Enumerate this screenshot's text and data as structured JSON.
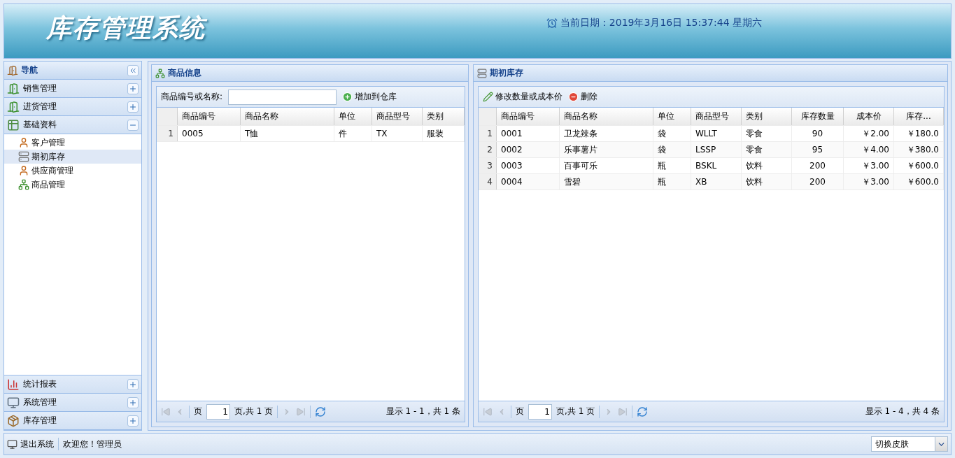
{
  "header": {
    "title": "库存管理系统",
    "date": "当前日期：2019年3月16日 15:37:44 星期六"
  },
  "sidebar": {
    "title": "导航",
    "sections": [
      {
        "label": "销售管理",
        "expanded": false
      },
      {
        "label": "进货管理",
        "expanded": false
      },
      {
        "label": "基础资料",
        "expanded": true,
        "children": [
          {
            "label": "客户管理",
            "selected": false
          },
          {
            "label": "期初库存",
            "selected": true
          },
          {
            "label": "供应商管理",
            "selected": false
          },
          {
            "label": "商品管理",
            "selected": false
          }
        ]
      },
      {
        "label": "统计报表",
        "expanded": false
      },
      {
        "label": "系统管理",
        "expanded": false
      },
      {
        "label": "库存管理",
        "expanded": false
      }
    ]
  },
  "panels": [
    {
      "title": "商品信息",
      "search_label": "商品编号或名称:",
      "toolbar": [
        "增加到仓库"
      ],
      "columns": [
        "商品编号",
        "商品名称",
        "单位",
        "商品型号",
        "类别"
      ],
      "rows": [
        {
          "number": "1",
          "cells": [
            "0005",
            "T恤",
            "件",
            "TX",
            "服装"
          ]
        }
      ],
      "pager": {
        "page_label": "页",
        "page": "1",
        "total_label": "页,共 1 页",
        "summary": "显示 1 - 1，共 1 条",
        "controls": [
          {
            "kind": "first",
            "disabled": true
          },
          {
            "kind": "prev",
            "disabled": true
          },
          {
            "kind": "next",
            "disabled": true
          },
          {
            "kind": "last",
            "disabled": true
          }
        ]
      }
    },
    {
      "title": "期初库存",
      "toolbar": [
        "修改数量或成本价",
        "删除"
      ],
      "columns": [
        "商品编号",
        "商品名称",
        "单位",
        "商品型号",
        "类别",
        "库存数量",
        "成本价",
        "库存..."
      ],
      "rows": [
        {
          "number": "1",
          "cells": [
            "0001",
            "卫龙辣条",
            "袋",
            "WLLT",
            "零食",
            "90",
            "￥2.00",
            "￥180.0"
          ]
        },
        {
          "number": "2",
          "cells": [
            "0002",
            "乐事薯片",
            "袋",
            "LSSP",
            "零食",
            "95",
            "￥4.00",
            "￥380.0"
          ]
        },
        {
          "number": "3",
          "cells": [
            "0003",
            "百事可乐",
            "瓶",
            "BSKL",
            "饮料",
            "200",
            "￥3.00",
            "￥600.0"
          ]
        },
        {
          "number": "4",
          "cells": [
            "0004",
            "雪碧",
            "瓶",
            "XB",
            "饮料",
            "200",
            "￥3.00",
            "￥600.0"
          ]
        }
      ],
      "pager": {
        "page_label": "页",
        "page": "1",
        "total_label": "页,共 1 页",
        "summary": "显示 1 - 4，共 4 条",
        "controls": [
          {
            "kind": "first",
            "disabled": true
          },
          {
            "kind": "prev",
            "disabled": true
          },
          {
            "kind": "next",
            "disabled": true
          },
          {
            "kind": "last",
            "disabled": true
          }
        ]
      }
    }
  ],
  "status_bar": {
    "logout": "退出系统",
    "welcome": "欢迎您！管理员",
    "skin_select": "切换皮肤"
  }
}
